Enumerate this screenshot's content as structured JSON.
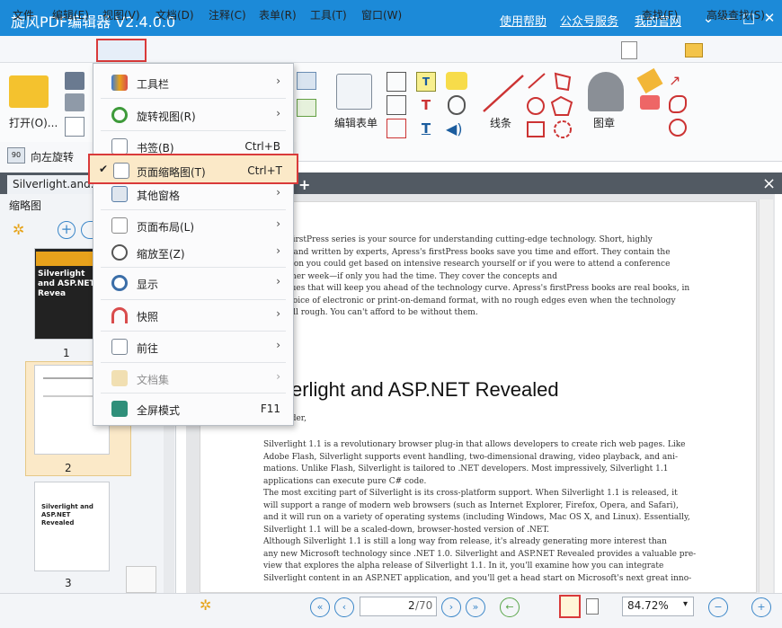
{
  "app": {
    "title": "旋风PDF编辑器 V2.4.0.0",
    "links": [
      "使用帮助",
      "公众号服务",
      "我的官网"
    ],
    "window_buttons": [
      "⌄",
      "—",
      "□",
      "✕"
    ]
  },
  "menubar": {
    "items": [
      "文件",
      "编辑(E)",
      "视图(V)",
      "文档(D)",
      "注释(C)",
      "表单(R)",
      "工具(T)",
      "窗口(W)"
    ],
    "right": [
      "查找(F)",
      "高级查找(S)"
    ]
  },
  "ribbon": {
    "open_label": "打开(O)...",
    "edit_form_label": "编辑表单",
    "line_label": "线条",
    "stamp_label": "图章",
    "rotate_left_label": "向左旋转"
  },
  "tab": {
    "filename": "Silverlight.and.ASP.NET",
    "plus": "+",
    "close": "×"
  },
  "sidebar": {
    "header": "缩略图",
    "pages": [
      "1",
      "2",
      "3"
    ],
    "thumb1_title": "Silverlight and ASP.NET Revea",
    "thumb3_title": "Silverlight and ASP.NET Revealed"
  },
  "dropdown": {
    "items": [
      {
        "label": "工具栏",
        "shortcut": "",
        "arrow": "›"
      },
      {
        "label": "旋转视图(R)",
        "shortcut": "",
        "arrow": "›"
      },
      {
        "label": "书签(B)",
        "shortcut": "Ctrl+B",
        "arrow": ""
      },
      {
        "label": "页面缩略图(T)",
        "shortcut": "Ctrl+T",
        "arrow": "",
        "checked": true
      },
      {
        "label": "其他窗格",
        "shortcut": "",
        "arrow": "›"
      },
      {
        "label": "页面布局(L)",
        "shortcut": "",
        "arrow": "›"
      },
      {
        "label": "缩放至(Z)",
        "shortcut": "",
        "arrow": "›"
      },
      {
        "label": "显示",
        "shortcut": "",
        "arrow": "›"
      },
      {
        "label": "快照",
        "shortcut": "",
        "arrow": "›"
      },
      {
        "label": "前往",
        "shortcut": "",
        "arrow": "›"
      },
      {
        "label": "文档集",
        "shortcut": "",
        "arrow": "›",
        "disabled": true
      },
      {
        "label": "全屏模式",
        "shortcut": "F11",
        "arrow": ""
      }
    ],
    "check_mark": "✔"
  },
  "document": {
    "para1_lines": [
      "s firstPress series is your source for understanding cutting-edge technology. Short, highly",
      "d, and written by experts, Apress's firstPress books save you time and effort. They contain the",
      "ation you could get based on intensive research yourself or if you were to attend a conference",
      "other week—if only you had the time. They cover the concepts and",
      "iques that will keep you ahead of the technology curve. Apress's firstPress books are real books, in",
      "choice of electronic or print-on-demand format, with no rough edges even when the technology",
      "still rough. You can't afford to be without them."
    ],
    "heading": "verlight and ASP.NET Revealed",
    "byline": "eader,",
    "para2_lines": [
      "Silverlight 1.1 is a revolutionary browser plug-in that allows developers to create rich web pages. Like",
      "Adobe Flash, Silverlight supports event handling, two-dimensional drawing, video playback, and ani-",
      "mations. Unlike Flash, Silverlight is tailored to .NET developers. Most impressively, Silverlight 1.1",
      "applications can execute pure C# code.",
      "      The most exciting part of Silverlight is its cross-platform support. When Silverlight 1.1 is released, it",
      "will support a range of modern web browsers (such as Internet Explorer, Firefox, Opera, and Safari),",
      "and it will run on a variety of operating systems (including Windows, Mac OS X, and Linux). Essentially,",
      "Silverlight 1.1 will be a scaled-down, browser-hosted version of .NET.",
      "      Although Silverlight 1.1 is still a long way from release, it's already generating more interest than",
      "any new Microsoft technology since .NET 1.0. Silverlight and ASP.NET Revealed provides a valuable pre-",
      "view that explores the alpha release of Silverlight 1.1. In it, you'll examine how you can integrate",
      "Silverlight content in an ASP.NET application, and you'll get a head start on Microsoft's next great inno-"
    ]
  },
  "statusbar": {
    "page_current": "2",
    "page_total": "/70",
    "zoom": "84.72%"
  }
}
